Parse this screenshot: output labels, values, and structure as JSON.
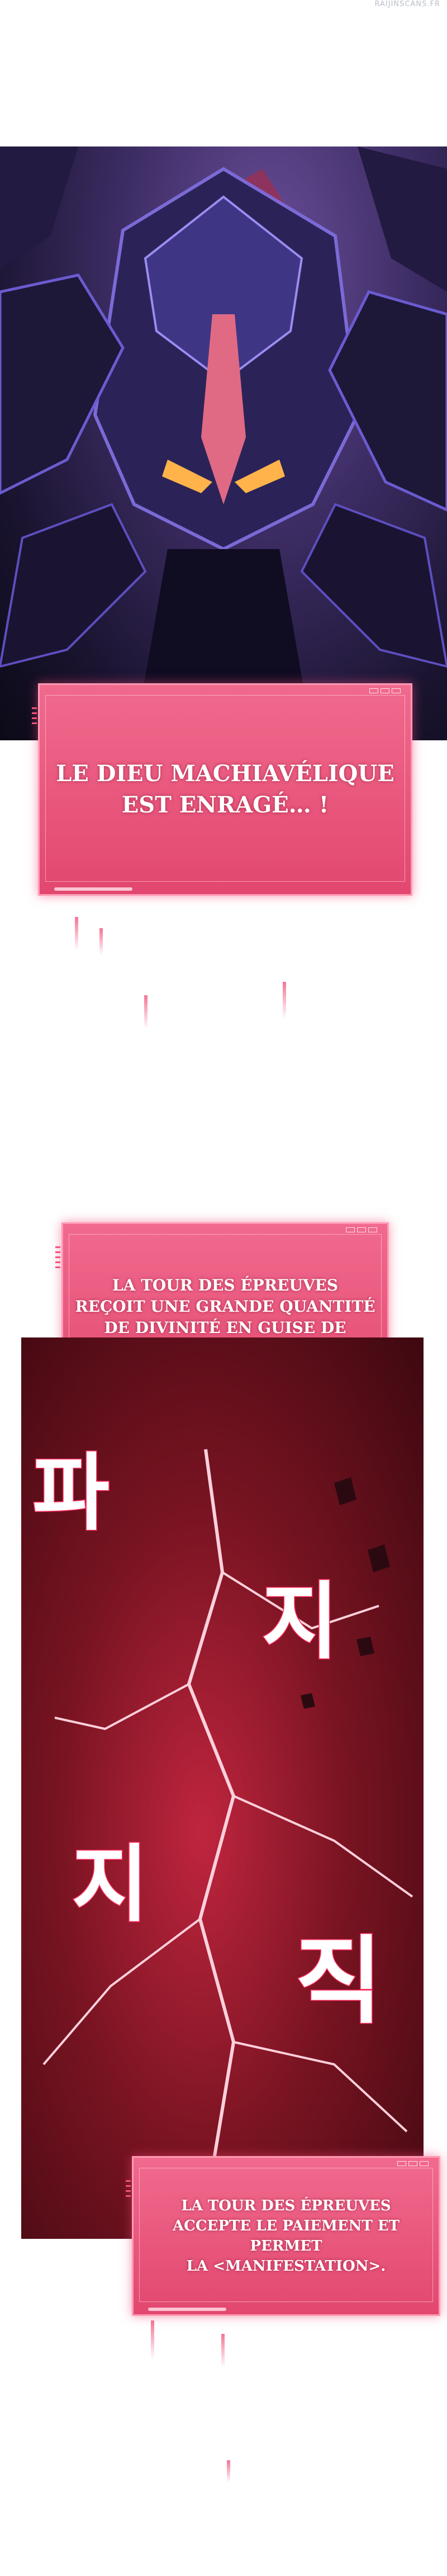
{
  "watermark": "RAIJINSCANS.FR",
  "panels": [
    {
      "description_icon": "demon-helmet-icon"
    },
    {
      "description_icon": "lightning-crack-icon"
    }
  ],
  "dialogues": {
    "box1": "LE DIEU MACHIAVÉLIQUE\nEST ENRAGÉ… !",
    "box2": "LA TOUR DES ÉPREUVES\nREÇOIT UNE GRANDE QUANTITÉ\nDE DIVINITÉ EN GUISE DE\nPAIEMENT.",
    "box3": "LA TOUR DES ÉPREUVES\nACCEPTE LE PAIEMENT ET PERMET\nLA <MANIFESTATION>."
  },
  "sound_effects": [
    "파",
    "지",
    "지",
    "직"
  ],
  "colors": {
    "system_box": "#e84a74",
    "system_border": "#ff9ab5",
    "panel_demon": "#3c2c63",
    "panel_crimson": "#7a1422"
  }
}
